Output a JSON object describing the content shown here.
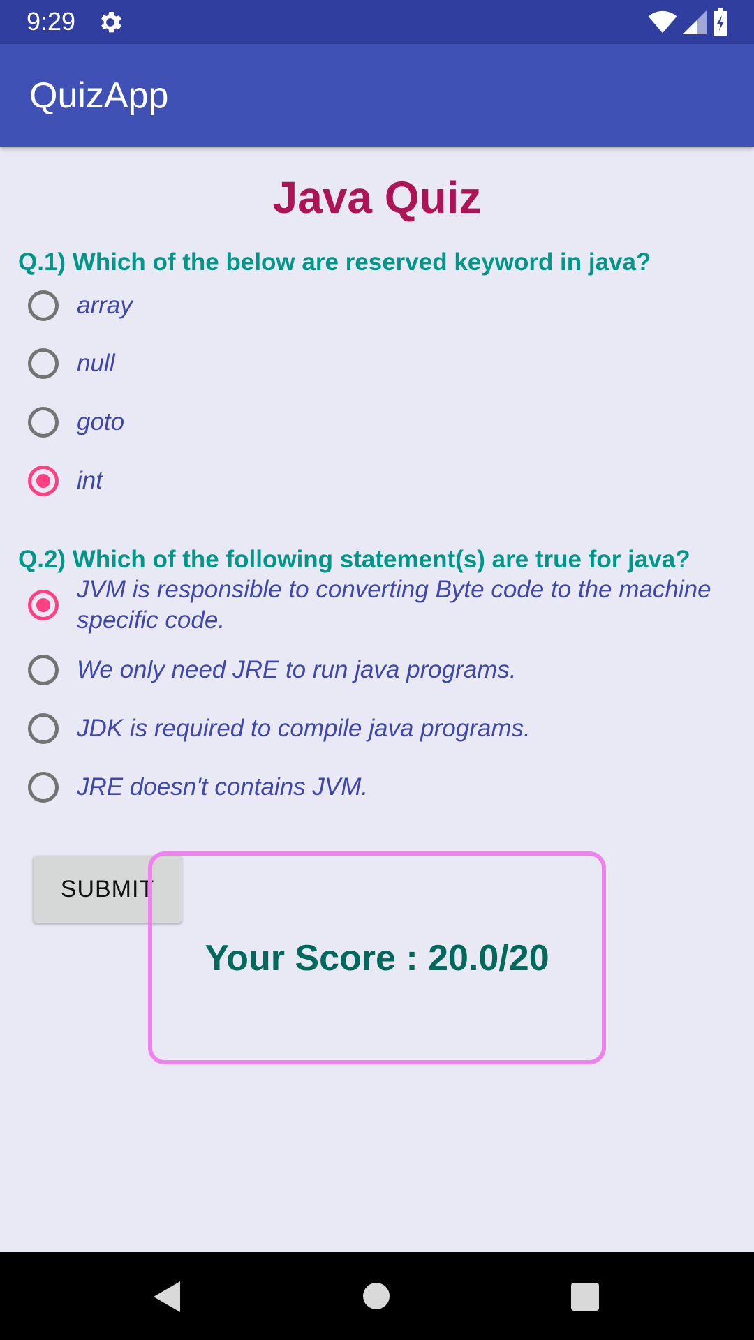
{
  "status_bar": {
    "time": "9:29",
    "icons": [
      "gear-icon",
      "wifi-icon",
      "cell-signal-icon",
      "battery-charging-icon"
    ]
  },
  "app_bar": {
    "title": "QuizApp"
  },
  "quiz": {
    "title": "Java Quiz",
    "questions": [
      {
        "text": "Q.1) Which of the below are reserved keyword in java?",
        "options": [
          {
            "label": "array",
            "checked": false
          },
          {
            "label": "null",
            "checked": false
          },
          {
            "label": "goto",
            "checked": false
          },
          {
            "label": "int",
            "checked": true
          }
        ]
      },
      {
        "text": "Q.2) Which of the following statement(s) are true for java?",
        "options": [
          {
            "label": "JVM is responsible to converting Byte code to the machine specific code.",
            "checked": true
          },
          {
            "label": "We only need JRE to run java programs.",
            "checked": false
          },
          {
            "label": "JDK is required to compile java programs.",
            "checked": false
          },
          {
            "label": "JRE doesn't contains JVM.",
            "checked": false
          }
        ]
      }
    ],
    "submit_label": "SUBMIT",
    "score_text": "Your Score : 20.0/20"
  },
  "colors": {
    "status_bar": "#303f9f",
    "app_bar": "#3f51b5",
    "quiz_title": "#ad1457",
    "question": "#009688",
    "option_text": "#3f48a8",
    "radio_checked": "#ff4081",
    "score_border": "#ee82ee",
    "score_text": "#00695c"
  },
  "nav_bar": {
    "icons": [
      "back-icon",
      "home-icon",
      "recent-apps-icon"
    ]
  }
}
